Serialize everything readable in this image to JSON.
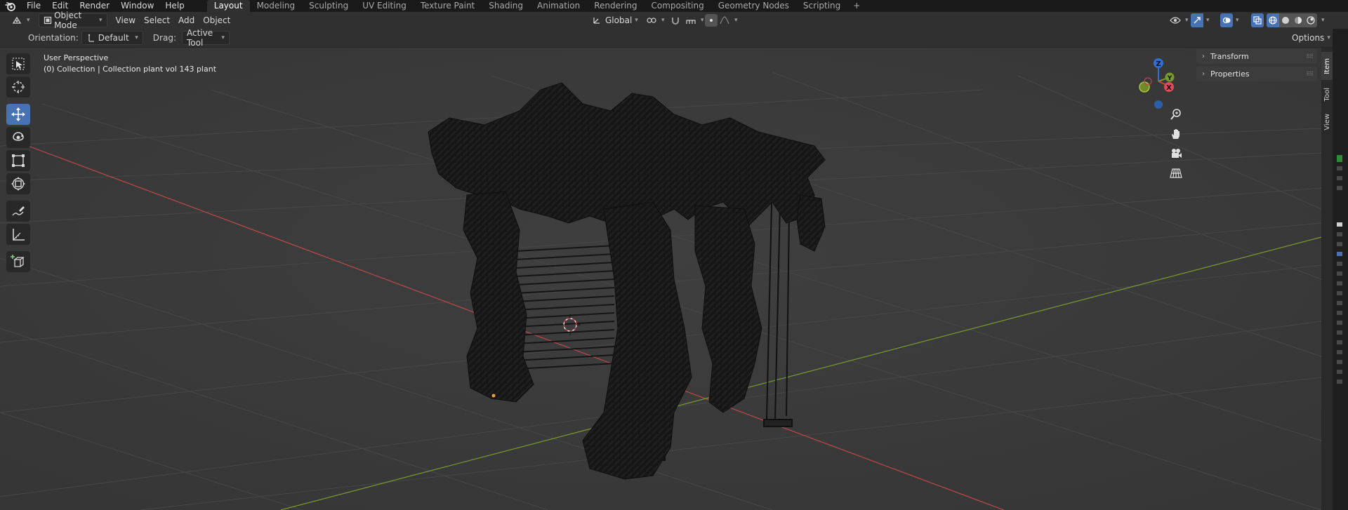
{
  "topbar": {
    "menus": [
      "File",
      "Edit",
      "Render",
      "Window",
      "Help"
    ],
    "workspaces": [
      "Layout",
      "Modeling",
      "Sculpting",
      "UV Editing",
      "Texture Paint",
      "Shading",
      "Animation",
      "Rendering",
      "Compositing",
      "Geometry Nodes",
      "Scripting"
    ],
    "active_workspace": "Layout",
    "add_tab": "+"
  },
  "header": {
    "mode": "Object Mode",
    "menus": [
      "View",
      "Select",
      "Add",
      "Object"
    ],
    "transform_orientation": "Global"
  },
  "tool_settings": {
    "orientation_label": "Orientation:",
    "orientation_value": "Default",
    "drag_label": "Drag:",
    "drag_value": "Active Tool",
    "options_label": "Options"
  },
  "viewport": {
    "view_name": "User Perspective",
    "collection_info": "(0) Collection | Collection plant vol 143 plant"
  },
  "gizmo": {
    "z_label": "Z",
    "y_label": "Y",
    "x_label": "X"
  },
  "npanel": {
    "panels": [
      "Transform",
      "Properties"
    ],
    "tabs": [
      "Item",
      "Tool",
      "View"
    ],
    "active_tab": "Item"
  },
  "colors": {
    "accent": "#4772b3",
    "x_axis": "#c04848",
    "y_axis": "#7a9a30",
    "z_axis": "#2e6fd6",
    "viewport_bg": "#3d3d3d"
  }
}
